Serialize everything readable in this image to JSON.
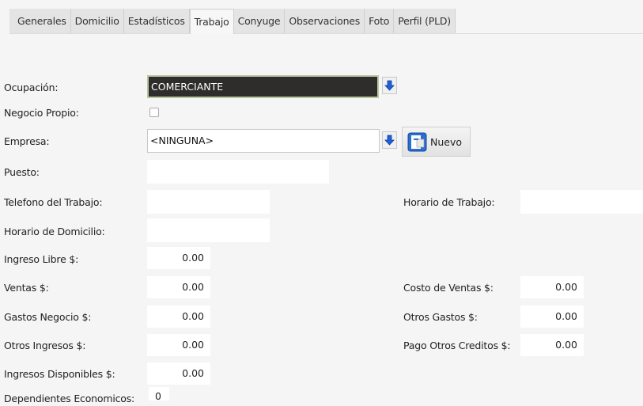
{
  "tabs": [
    "Generales",
    "Domicilio",
    "Estadísticos",
    "Trabajo",
    "Conyuge",
    "Observaciones",
    "Foto",
    "Perfil (PLD)"
  ],
  "active_tab": "Trabajo",
  "form": {
    "ocupacion_label": "Ocupación:",
    "ocupacion_value": "COMERCIANTE",
    "negocio_propio_label": "Negocio Propio:",
    "empresa_label": "Empresa:",
    "empresa_value": "<NINGUNA>",
    "nuevo_button": "Nuevo",
    "puesto_label": "Puesto:",
    "telefono_label": "Telefono del Trabajo:",
    "horario_trabajo_label": "Horario de Trabajo:",
    "horario_domicilio_label": "Horario de Domicilio:",
    "ingreso_libre_label": "Ingreso Libre $:",
    "ingreso_libre_value": "0.00",
    "ventas_label": "Ventas $:",
    "ventas_value": "0.00",
    "costo_ventas_label": "Costo de Ventas $:",
    "costo_ventas_value": "0.00",
    "gastos_negocio_label": "Gastos Negocio $:",
    "gastos_negocio_value": "0.00",
    "otros_gastos_label": "Otros Gastos $:",
    "otros_gastos_value": "0.00",
    "otros_ingresos_label": "Otros Ingresos $:",
    "otros_ingresos_value": "0.00",
    "pago_otros_creditos_label": "Pago Otros Creditos $:",
    "pago_otros_creditos_value": "0.00",
    "ingresos_disponibles_label": "Ingresos Disponibles $:",
    "ingresos_disponibles_value": "0.00",
    "dependientes_label": "Dependientes Economicos:",
    "dependientes_value": "0"
  },
  "colors": {
    "arrow": "#1f5fd6",
    "dark_select": "#2f2d2b"
  }
}
